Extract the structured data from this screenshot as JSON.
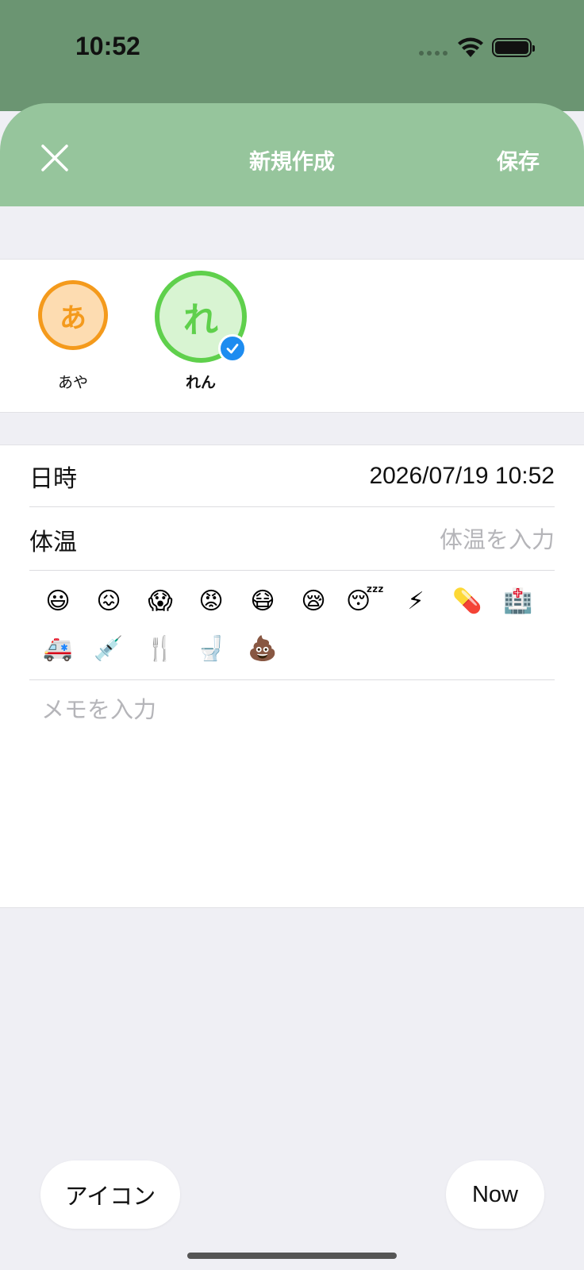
{
  "status_bar": {
    "time": "10:52"
  },
  "header": {
    "title": "新規作成",
    "save_label": "保存"
  },
  "people": [
    {
      "initial": "あ",
      "name": "あや",
      "selected": false,
      "color": "#f49a1c"
    },
    {
      "initial": "れ",
      "name": "れん",
      "selected": true,
      "color": "#5fd04c"
    }
  ],
  "form": {
    "datetime_label": "日時",
    "datetime_value": "2026/07/19 10:52",
    "temperature_label": "体温",
    "temperature_placeholder": "体温を入力",
    "memo_placeholder": "メモを入力"
  },
  "emojis": [
    "😃",
    "😖",
    "😱",
    "😡",
    "😷",
    "😪",
    "😴",
    "⚡",
    "💊",
    "🏥",
    "🚑",
    "💉",
    "🍴",
    "🚽",
    "💩"
  ],
  "bottom": {
    "icon_button": "アイコン",
    "now_button": "Now"
  },
  "colors": {
    "header_green": "#96c59c",
    "status_green": "#6b9572",
    "check_blue": "#1e8cf0"
  }
}
